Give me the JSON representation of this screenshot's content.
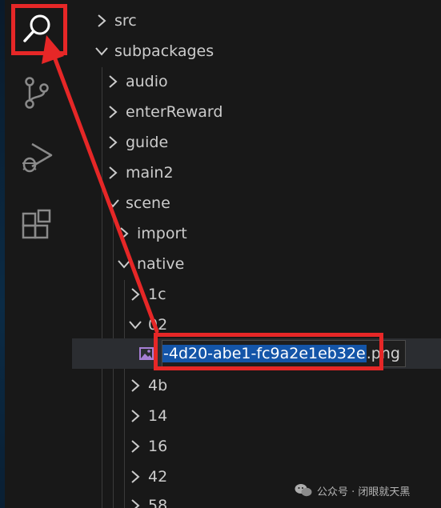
{
  "activity_bar": {
    "icons": [
      "search-icon",
      "source-control-icon",
      "run-debug-icon",
      "extensions-icon"
    ]
  },
  "tree": {
    "items": [
      {
        "label": "src",
        "expanded": false
      },
      {
        "label": "subpackages",
        "expanded": true
      },
      {
        "label": "audio",
        "expanded": false
      },
      {
        "label": "enterReward",
        "expanded": false
      },
      {
        "label": "guide",
        "expanded": false
      },
      {
        "label": "main2",
        "expanded": false
      },
      {
        "label": "scene",
        "expanded": true
      },
      {
        "label": "import",
        "expanded": false
      },
      {
        "label": "native",
        "expanded": true
      },
      {
        "label": "1c",
        "expanded": false
      },
      {
        "label": "02",
        "expanded": true
      },
      {
        "label": "4b",
        "expanded": false
      },
      {
        "label": "14",
        "expanded": false
      },
      {
        "label": "16",
        "expanded": false
      },
      {
        "label": "42",
        "expanded": false
      },
      {
        "label": "58",
        "expanded": false
      }
    ],
    "rename": {
      "selected_text": "-4d20-abe1-fc9a2e1eb32e",
      "rest_text": ".png",
      "file_icon": "image-file-icon"
    }
  },
  "watermark": {
    "text": "公众号 · 闭眼就天黑"
  },
  "colors": {
    "annotation": "#e62727",
    "selection": "#1455a8",
    "background": "#181818"
  }
}
